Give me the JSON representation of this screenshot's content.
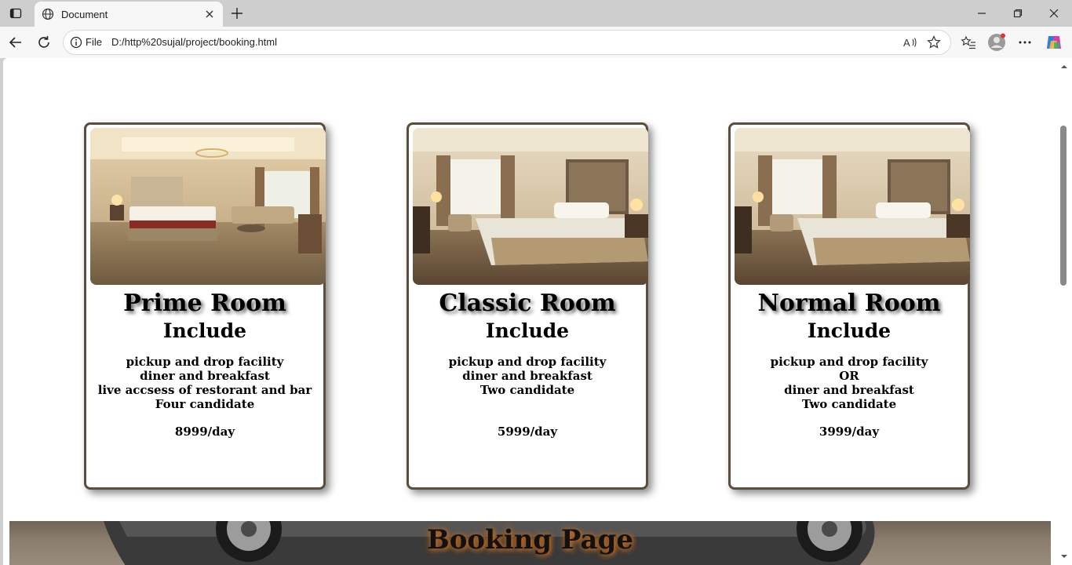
{
  "browser": {
    "tab_title": "Document",
    "address_prefix": "File",
    "url": "D:/http%20sujal/project/booking.html",
    "icons": [
      "sidebar-toggle-icon",
      "globe-icon",
      "close-icon",
      "plus-icon",
      "minimize-icon",
      "restore-icon",
      "window-close-icon",
      "back-arrow-icon",
      "refresh-icon",
      "info-icon",
      "read-aloud-icon",
      "favorite-star-icon",
      "favorites-list-icon",
      "profile-avatar-icon",
      "more-icon",
      "copilot-icon"
    ]
  },
  "page": {
    "cards": [
      {
        "name": "Prime Room",
        "include": "Include",
        "features": [
          "pickup and drop facility",
          "diner and breakfast",
          "live accsess of restorant and bar",
          "Four candidate"
        ],
        "price": "8999/day"
      },
      {
        "name": "Classic Room",
        "include": "Include",
        "features": [
          "pickup and drop facility",
          "diner and breakfast",
          "Two candidate"
        ],
        "price": "5999/day"
      },
      {
        "name": "Normal Room",
        "include": "Include",
        "features": [
          "pickup and drop facility",
          "OR",
          "diner and breakfast",
          "Two candidate"
        ],
        "price": "3999/day"
      }
    ],
    "banner_title": "Booking Page"
  },
  "colors": {
    "card_border": "#5a4e3e",
    "banner_glow": "#c06a1d",
    "chrome_bg": "#cecece",
    "toolbar_bg": "#f7f7f7"
  }
}
